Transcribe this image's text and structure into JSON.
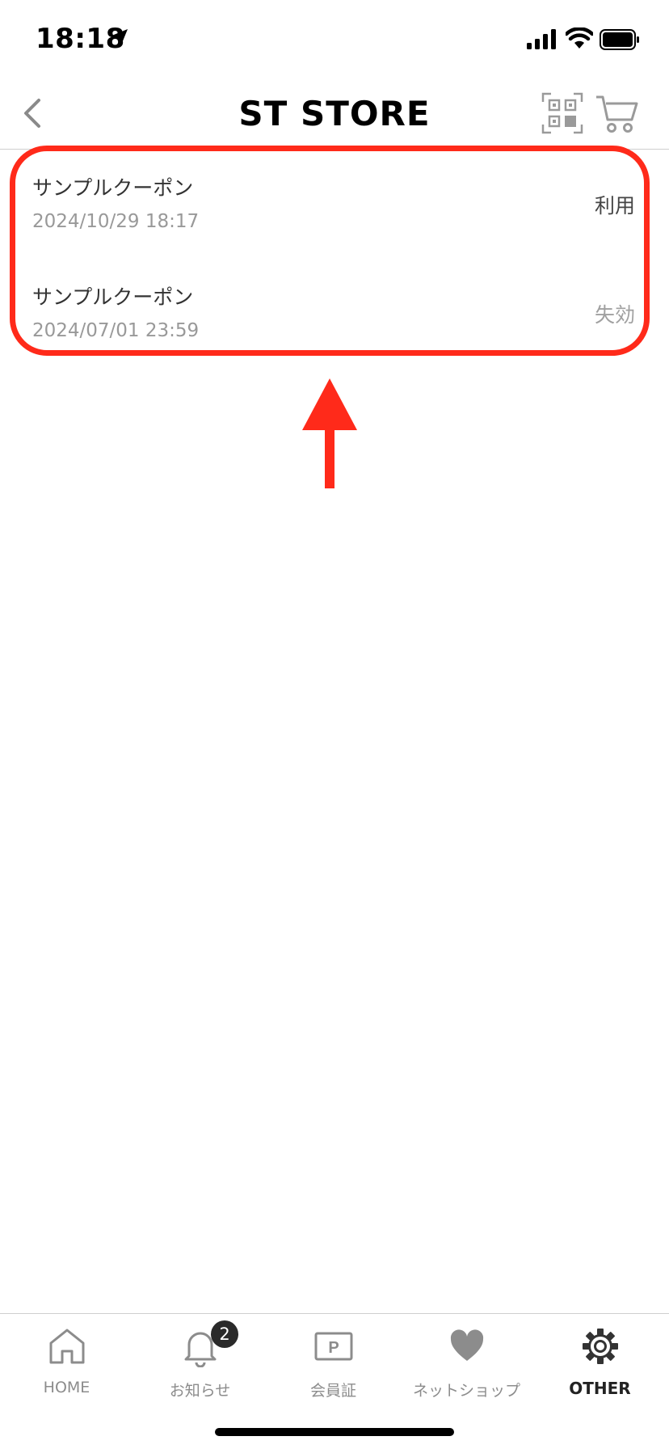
{
  "status_bar": {
    "time": "18:18"
  },
  "header": {
    "title": "ST STORE"
  },
  "coupons": [
    {
      "name": "サンプルクーポン",
      "date": "2024/10/29 18:17",
      "status": "利用"
    },
    {
      "name": "サンプルクーポン",
      "date": "2024/07/01 23:59",
      "status": "失効"
    }
  ],
  "tabbar": {
    "items": [
      {
        "label": "HOME",
        "icon": "home-icon"
      },
      {
        "label": "お知らせ",
        "icon": "bell-icon",
        "badge": "2"
      },
      {
        "label": "会員証",
        "icon": "member-card-icon",
        "icon_text": "P"
      },
      {
        "label": "ネットショップ",
        "icon": "heart-icon"
      },
      {
        "label": "OTHER",
        "icon": "gear-icon",
        "active": true
      }
    ]
  },
  "colors": {
    "annotation": "#ff2a1a",
    "inactive": "#8c8c8c",
    "active": "#222222"
  }
}
